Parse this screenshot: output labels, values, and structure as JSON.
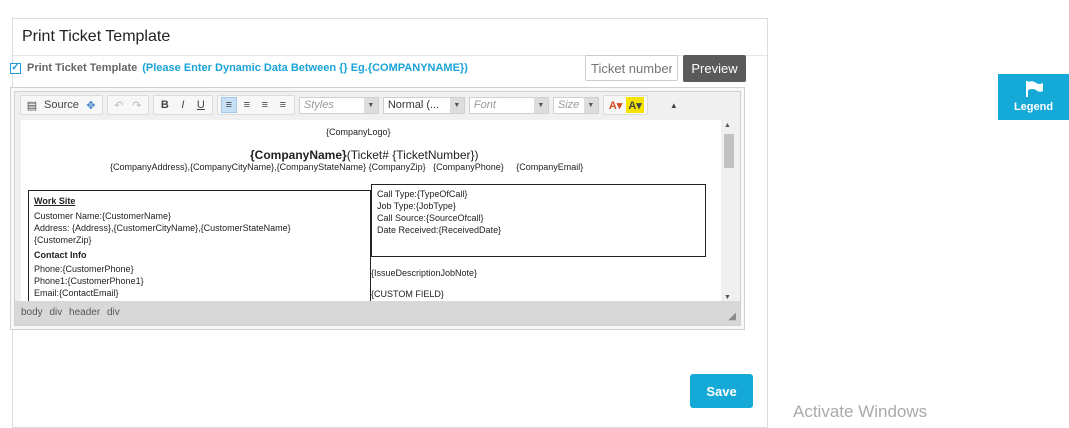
{
  "panel": {
    "title": "Print Ticket Template"
  },
  "options": {
    "checkbox_checked": true,
    "label": "Print Ticket Template",
    "hint": "(Please Enter Dynamic Data Between {} Eg.{COMPANYNAME})"
  },
  "ticket_input": {
    "placeholder": "Ticket number"
  },
  "preview_label": "Preview",
  "toolbar": {
    "source_label": "Source",
    "styles_label": "Styles",
    "format_label": "Normal (...",
    "font_label": "Font",
    "size_label": "Size"
  },
  "template": {
    "company_logo": "{CompanyLogo}",
    "company_name": "{CompanyName}",
    "ticket_part": "(Ticket# {TicketNumber})",
    "address_line": "{CompanyAddress},{CompanyCityName},{CompanyStateName} {CompanyZip}   {CompanyPhone}     {CompanyEmail}",
    "work_site": "Work Site",
    "customer_name": "Customer Name:{CustomerName}",
    "address": "Address: {Address},{CustomerCityName},{CustomerStateName}",
    "customer_zip": "{CustomerZip}",
    "contact_info": "Contact Info",
    "phone": "Phone:{CustomerPhone}",
    "phone1": "Phone1:{CustomerPhone1}",
    "email": "Email:{ContactEmail}",
    "call_type": "Call Type:{TypeOfCall}",
    "job_type": "Job Type:{JobType}",
    "call_source": "Call Source:{SourceOfcall}",
    "date_received": "Date Received:{ReceivedDate}",
    "issue_note": "{IssueDescriptionJobNote}",
    "custom_field": "{CUSTOM FIELD}"
  },
  "path_bar": "body div header div",
  "save_label": "Save",
  "legend_label": "Legend",
  "watermark": "Activate Windows",
  "colors": {
    "accent": "#15a9d8",
    "preview": "#5a5a5a"
  }
}
